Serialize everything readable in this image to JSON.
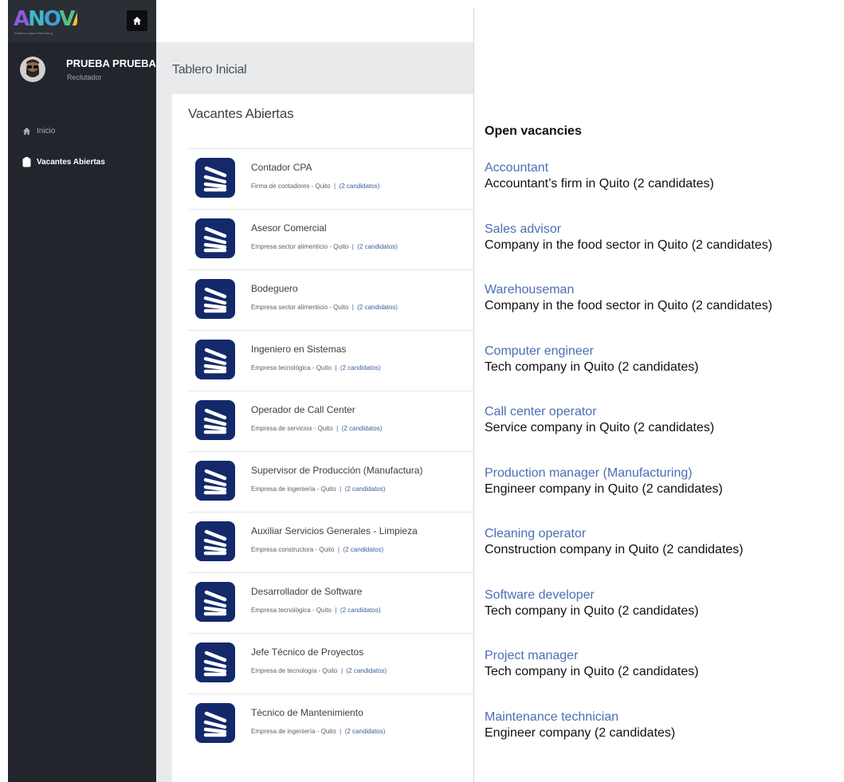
{
  "sidebar": {
    "logo_text": "ANOVA",
    "logo_tagline": "Evidence-based Recruiting",
    "user_name": "PRUEBA PRUEBA",
    "user_role": "Reclutador",
    "nav": [
      {
        "label": "Inicio",
        "icon": "home-icon",
        "active": false
      },
      {
        "label": "Vacantes Abiertas",
        "icon": "clipboard-icon",
        "active": true
      }
    ]
  },
  "colors": {
    "sidebar_bg": "#22252b",
    "vacancy_logo_bg": "#14296a",
    "link_blue": "#4a6fb5"
  },
  "main": {
    "page_title": "Tablero Inicial",
    "card_title": "Vacantes Abiertas",
    "vacancies": [
      {
        "title": "Contador CPA",
        "company": "Firma de contadores - Quito",
        "candidates": "(2 candidatos)"
      },
      {
        "title": "Asesor Comercial",
        "company": "Empresa sector alimenticio - Quito",
        "candidates": "(2 candidatos)"
      },
      {
        "title": "Bodeguero",
        "company": "Empresa sector alimenticio - Quito",
        "candidates": "(2 candidatos)"
      },
      {
        "title": "Ingeniero en Sistemas",
        "company": "Empresa tecnológica - Quito",
        "candidates": "(2 candidatos)"
      },
      {
        "title": "Operador de Call Center",
        "company": "Empresa de servicios - Quito",
        "candidates": "(2 candidatos)"
      },
      {
        "title": "Supervisor de Producción (Manufactura)",
        "company": "Empresa de ingeniería - Quito",
        "candidates": "(2 candidatos)"
      },
      {
        "title": "Auxiliar Servicios Generales - Limpieza",
        "company": "Empresa constructora - Quito",
        "candidates": "(2 candidatos)"
      },
      {
        "title": "Desarrollador de Software",
        "company": "Empresa tecnológica - Quito",
        "candidates": "(2 candidatos)"
      },
      {
        "title": "Jefe Técnico de Proyectos",
        "company": "Empresa de tecnología - Quito",
        "candidates": "(2 candidatos)"
      },
      {
        "title": "Técnico de Mantenimiento",
        "company": "Empresa de ingeniería - Quito",
        "candidates": "(2 candidatos)"
      }
    ]
  },
  "translation": {
    "heading": "Open vacancies",
    "items": [
      {
        "title": "Accountant",
        "desc": "Accountant’s firm in Quito (2 candidates)"
      },
      {
        "title": "Sales advisor",
        "desc": "Company in the food sector in Quito (2 candidates)"
      },
      {
        "title": "Warehouseman",
        "desc": " Company in the food sector in Quito (2 candidates)"
      },
      {
        "title": "Computer engineer",
        "desc": "Tech company in Quito (2 candidates)"
      },
      {
        "title": "Call center operator",
        "desc": "Service company in Quito (2 candidates)"
      },
      {
        "title": "Production manager (Manufacturing)",
        "desc": "Engineer company in Quito (2 candidates)"
      },
      {
        "title": "Cleaning operator",
        "desc": "Construction company in Quito (2 candidates)"
      },
      {
        "title": "Software developer",
        "desc": "Tech company in Quito (2 candidates)"
      },
      {
        "title": "Project manager",
        "desc": "Tech company in Quito (2 candidates)"
      },
      {
        "title": "Maintenance technician",
        "desc": "Engineer company (2 candidates)"
      }
    ]
  }
}
